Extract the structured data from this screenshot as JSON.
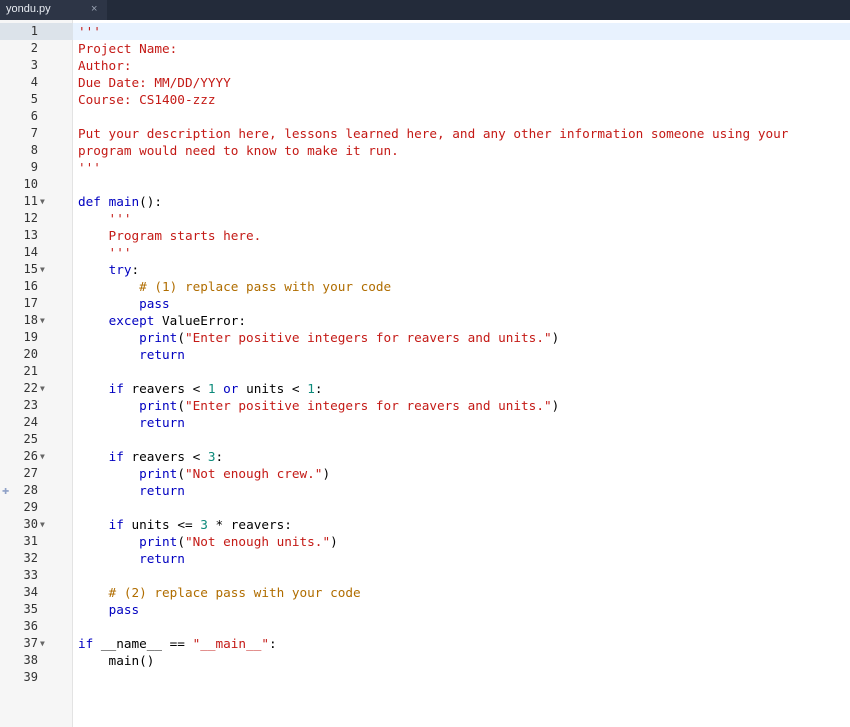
{
  "tab": {
    "filename": "yondu.py",
    "close_glyph": "×"
  },
  "colors": {
    "keyword": "#0000c0",
    "string": "#c41a16",
    "comment": "#b06d00",
    "number": "#0b8a7a",
    "tabbar": "#232b3a"
  },
  "editor": {
    "lines": [
      {
        "n": "1",
        "fold": false,
        "segments": [
          {
            "t": "'''",
            "c": "str"
          }
        ]
      },
      {
        "n": "2",
        "fold": false,
        "segments": [
          {
            "t": "Project Name:",
            "c": "str"
          }
        ]
      },
      {
        "n": "3",
        "fold": false,
        "segments": [
          {
            "t": "Author:",
            "c": "str"
          }
        ]
      },
      {
        "n": "4",
        "fold": false,
        "segments": [
          {
            "t": "Due Date: MM/DD/YYYY",
            "c": "str"
          }
        ]
      },
      {
        "n": "5",
        "fold": false,
        "segments": [
          {
            "t": "Course: CS1400-zzz",
            "c": "str"
          }
        ]
      },
      {
        "n": "6",
        "fold": false,
        "segments": []
      },
      {
        "n": "7",
        "fold": false,
        "segments": [
          {
            "t": "Put your description here, lessons learned here, and any other information someone using your",
            "c": "str"
          }
        ]
      },
      {
        "n": "8",
        "fold": false,
        "segments": [
          {
            "t": "program would need to know to make it run.",
            "c": "str"
          }
        ]
      },
      {
        "n": "9",
        "fold": false,
        "segments": [
          {
            "t": "'''",
            "c": "str"
          }
        ]
      },
      {
        "n": "10",
        "fold": false,
        "segments": []
      },
      {
        "n": "11",
        "fold": true,
        "segments": [
          {
            "t": "def ",
            "c": "kw"
          },
          {
            "t": "main",
            "c": "fn"
          },
          {
            "t": "():",
            "c": ""
          }
        ]
      },
      {
        "n": "12",
        "fold": false,
        "segments": [
          {
            "t": "    '''",
            "c": "str"
          }
        ]
      },
      {
        "n": "13",
        "fold": false,
        "segments": [
          {
            "t": "    Program starts here.",
            "c": "str"
          }
        ]
      },
      {
        "n": "14",
        "fold": false,
        "segments": [
          {
            "t": "    '''",
            "c": "str"
          }
        ]
      },
      {
        "n": "15",
        "fold": true,
        "segments": [
          {
            "t": "    ",
            "c": ""
          },
          {
            "t": "try",
            "c": "kw"
          },
          {
            "t": ":",
            "c": ""
          }
        ]
      },
      {
        "n": "16",
        "fold": false,
        "segments": [
          {
            "t": "        # (1) replace pass with your code",
            "c": "cm"
          }
        ]
      },
      {
        "n": "17",
        "fold": false,
        "segments": [
          {
            "t": "        ",
            "c": ""
          },
          {
            "t": "pass",
            "c": "kw"
          }
        ]
      },
      {
        "n": "18",
        "fold": true,
        "segments": [
          {
            "t": "    ",
            "c": ""
          },
          {
            "t": "except",
            "c": "kw"
          },
          {
            "t": " ValueError:",
            "c": ""
          }
        ]
      },
      {
        "n": "19",
        "fold": false,
        "segments": [
          {
            "t": "        ",
            "c": ""
          },
          {
            "t": "print",
            "c": "fn"
          },
          {
            "t": "(",
            "c": ""
          },
          {
            "t": "\"Enter positive integers for reavers and units.\"",
            "c": "str"
          },
          {
            "t": ")",
            "c": ""
          }
        ]
      },
      {
        "n": "20",
        "fold": false,
        "segments": [
          {
            "t": "        ",
            "c": ""
          },
          {
            "t": "return",
            "c": "kw"
          }
        ]
      },
      {
        "n": "21",
        "fold": false,
        "segments": []
      },
      {
        "n": "22",
        "fold": true,
        "segments": [
          {
            "t": "    ",
            "c": ""
          },
          {
            "t": "if",
            "c": "kw"
          },
          {
            "t": " reavers < ",
            "c": ""
          },
          {
            "t": "1",
            "c": "num"
          },
          {
            "t": " ",
            "c": ""
          },
          {
            "t": "or",
            "c": "kw"
          },
          {
            "t": " units < ",
            "c": ""
          },
          {
            "t": "1",
            "c": "num"
          },
          {
            "t": ":",
            "c": ""
          }
        ]
      },
      {
        "n": "23",
        "fold": false,
        "segments": [
          {
            "t": "        ",
            "c": ""
          },
          {
            "t": "print",
            "c": "fn"
          },
          {
            "t": "(",
            "c": ""
          },
          {
            "t": "\"Enter positive integers for reavers and units.\"",
            "c": "str"
          },
          {
            "t": ")",
            "c": ""
          }
        ]
      },
      {
        "n": "24",
        "fold": false,
        "segments": [
          {
            "t": "        ",
            "c": ""
          },
          {
            "t": "return",
            "c": "kw"
          }
        ]
      },
      {
        "n": "25",
        "fold": false,
        "segments": []
      },
      {
        "n": "26",
        "fold": true,
        "segments": [
          {
            "t": "    ",
            "c": ""
          },
          {
            "t": "if",
            "c": "kw"
          },
          {
            "t": " reavers < ",
            "c": ""
          },
          {
            "t": "3",
            "c": "num"
          },
          {
            "t": ":",
            "c": ""
          }
        ]
      },
      {
        "n": "27",
        "fold": false,
        "segments": [
          {
            "t": "        ",
            "c": ""
          },
          {
            "t": "print",
            "c": "fn"
          },
          {
            "t": "(",
            "c": ""
          },
          {
            "t": "\"Not enough crew.\"",
            "c": "str"
          },
          {
            "t": ")",
            "c": ""
          }
        ]
      },
      {
        "n": "28",
        "fold": false,
        "breakpoint": true,
        "segments": [
          {
            "t": "        ",
            "c": ""
          },
          {
            "t": "return",
            "c": "kw"
          }
        ]
      },
      {
        "n": "29",
        "fold": false,
        "segments": []
      },
      {
        "n": "30",
        "fold": true,
        "segments": [
          {
            "t": "    ",
            "c": ""
          },
          {
            "t": "if",
            "c": "kw"
          },
          {
            "t": " units <= ",
            "c": ""
          },
          {
            "t": "3",
            "c": "num"
          },
          {
            "t": " * reavers:",
            "c": ""
          }
        ]
      },
      {
        "n": "31",
        "fold": false,
        "segments": [
          {
            "t": "        ",
            "c": ""
          },
          {
            "t": "print",
            "c": "fn"
          },
          {
            "t": "(",
            "c": ""
          },
          {
            "t": "\"Not enough units.\"",
            "c": "str"
          },
          {
            "t": ")",
            "c": ""
          }
        ]
      },
      {
        "n": "32",
        "fold": false,
        "segments": [
          {
            "t": "        ",
            "c": ""
          },
          {
            "t": "return",
            "c": "kw"
          }
        ]
      },
      {
        "n": "33",
        "fold": false,
        "segments": []
      },
      {
        "n": "34",
        "fold": false,
        "segments": [
          {
            "t": "    # (2) replace pass with your code",
            "c": "cm"
          }
        ]
      },
      {
        "n": "35",
        "fold": false,
        "segments": [
          {
            "t": "    ",
            "c": ""
          },
          {
            "t": "pass",
            "c": "kw"
          }
        ]
      },
      {
        "n": "36",
        "fold": false,
        "segments": []
      },
      {
        "n": "37",
        "fold": true,
        "segments": [
          {
            "t": "if",
            "c": "kw"
          },
          {
            "t": " __name__ == ",
            "c": ""
          },
          {
            "t": "\"__main__\"",
            "c": "str"
          },
          {
            "t": ":",
            "c": ""
          }
        ]
      },
      {
        "n": "38",
        "fold": false,
        "segments": [
          {
            "t": "    main()",
            "c": ""
          }
        ]
      },
      {
        "n": "39",
        "fold": false,
        "segments": []
      }
    ]
  }
}
